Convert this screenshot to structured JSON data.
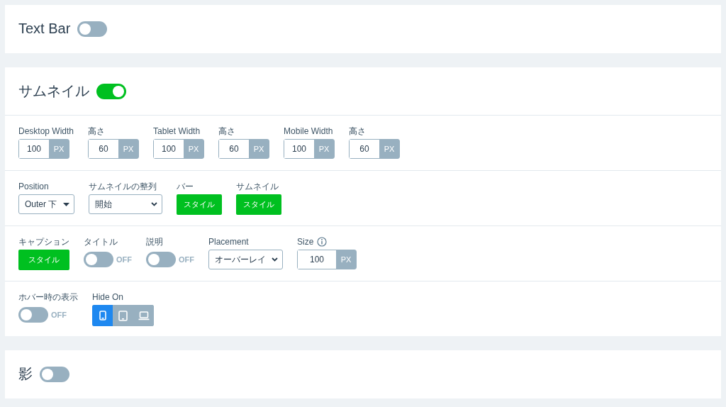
{
  "sections": [
    {
      "title": "Text Bar",
      "on": false
    },
    {
      "title": "サムネイル",
      "on": true,
      "rows": [
        {
          "fields": [
            {
              "kind": "unit",
              "label": "Desktop Width",
              "value": "100",
              "unit": "PX"
            },
            {
              "kind": "unit",
              "label": "高さ",
              "value": "60",
              "unit": "PX"
            },
            {
              "kind": "unit",
              "label": "Tablet Width",
              "value": "100",
              "unit": "PX"
            },
            {
              "kind": "unit",
              "label": "高さ",
              "value": "60",
              "unit": "PX"
            },
            {
              "kind": "unit",
              "label": "Mobile Width",
              "value": "100",
              "unit": "PX"
            },
            {
              "kind": "unit",
              "label": "高さ",
              "value": "60",
              "unit": "PX"
            }
          ]
        },
        {
          "fields": [
            {
              "kind": "dropdown",
              "label": "Position",
              "value": "Outer 下"
            },
            {
              "kind": "select",
              "label": "サムネイルの整列",
              "value": "開始"
            },
            {
              "kind": "button",
              "label": "バー",
              "button": "スタイル"
            },
            {
              "kind": "button",
              "label": "サムネイル",
              "button": "スタイル"
            }
          ]
        },
        {
          "fields": [
            {
              "kind": "button",
              "label": "キャプション",
              "button": "スタイル"
            },
            {
              "kind": "toggle",
              "label": "タイトル",
              "on": false,
              "state_text": "OFF"
            },
            {
              "kind": "toggle",
              "label": "説明",
              "on": false,
              "state_text": "OFF"
            },
            {
              "kind": "select",
              "label": "Placement",
              "value": "オーバーレイ"
            },
            {
              "kind": "unit",
              "label": "Size",
              "info": true,
              "value": "100",
              "unit": "PX"
            }
          ]
        },
        {
          "fields": [
            {
              "kind": "toggle",
              "label": "ホバー時の表示",
              "on": false,
              "state_text": "OFF"
            },
            {
              "kind": "devices",
              "label": "Hide On",
              "items": [
                {
                  "kind": "phone",
                  "selected": true
                },
                {
                  "kind": "tablet",
                  "selected": false
                },
                {
                  "kind": "laptop",
                  "selected": false
                }
              ]
            }
          ]
        }
      ]
    },
    {
      "title": "影",
      "on": false
    }
  ]
}
